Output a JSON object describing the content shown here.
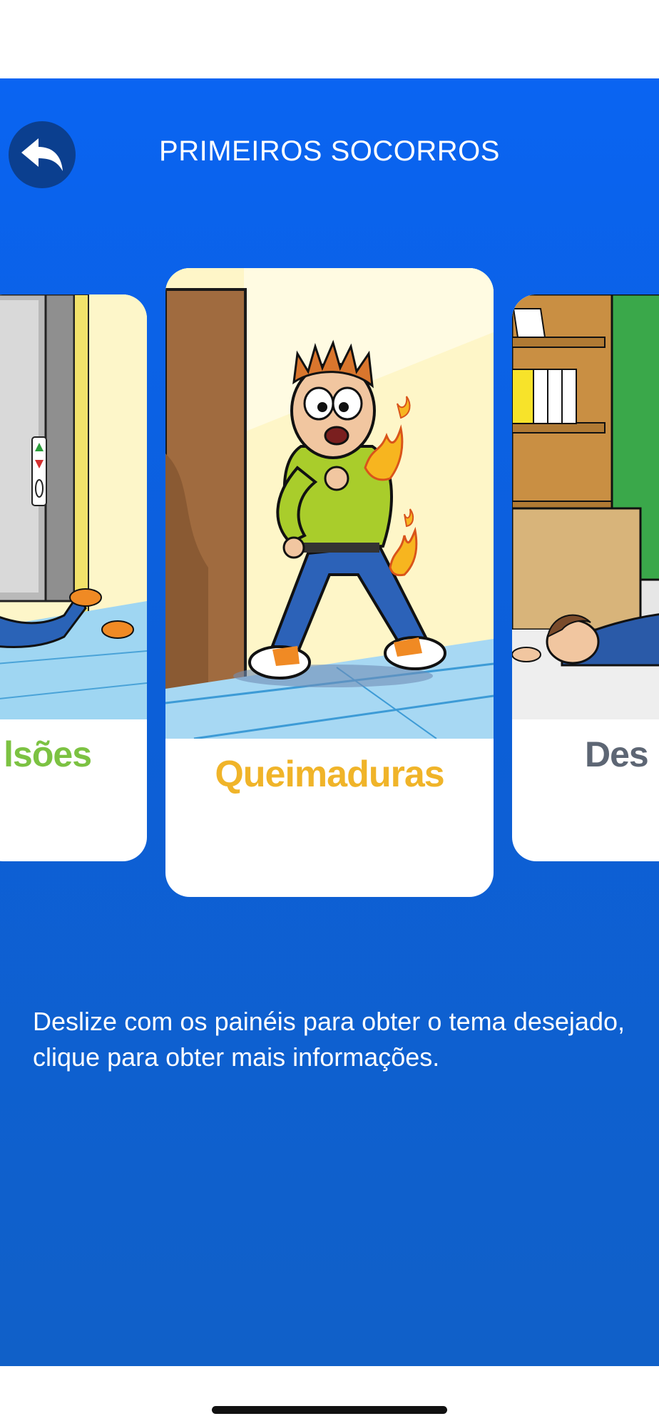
{
  "header": {
    "title": "PRIMEIROS SOCORROS",
    "back_icon": "back-arrow-icon"
  },
  "carousel": {
    "cards": [
      {
        "label": "lsões",
        "label_color": "#7cc242"
      },
      {
        "label": "Queimaduras",
        "label_color": "#f0b429"
      },
      {
        "label": "Des",
        "label_color": "#5d6674"
      }
    ]
  },
  "instructions": {
    "text": "Deslize com os painéis para obter o tema desejado, clique para obter mais informações."
  },
  "colors": {
    "background": "#0a64f2",
    "back_button": "#0b3f8f"
  }
}
